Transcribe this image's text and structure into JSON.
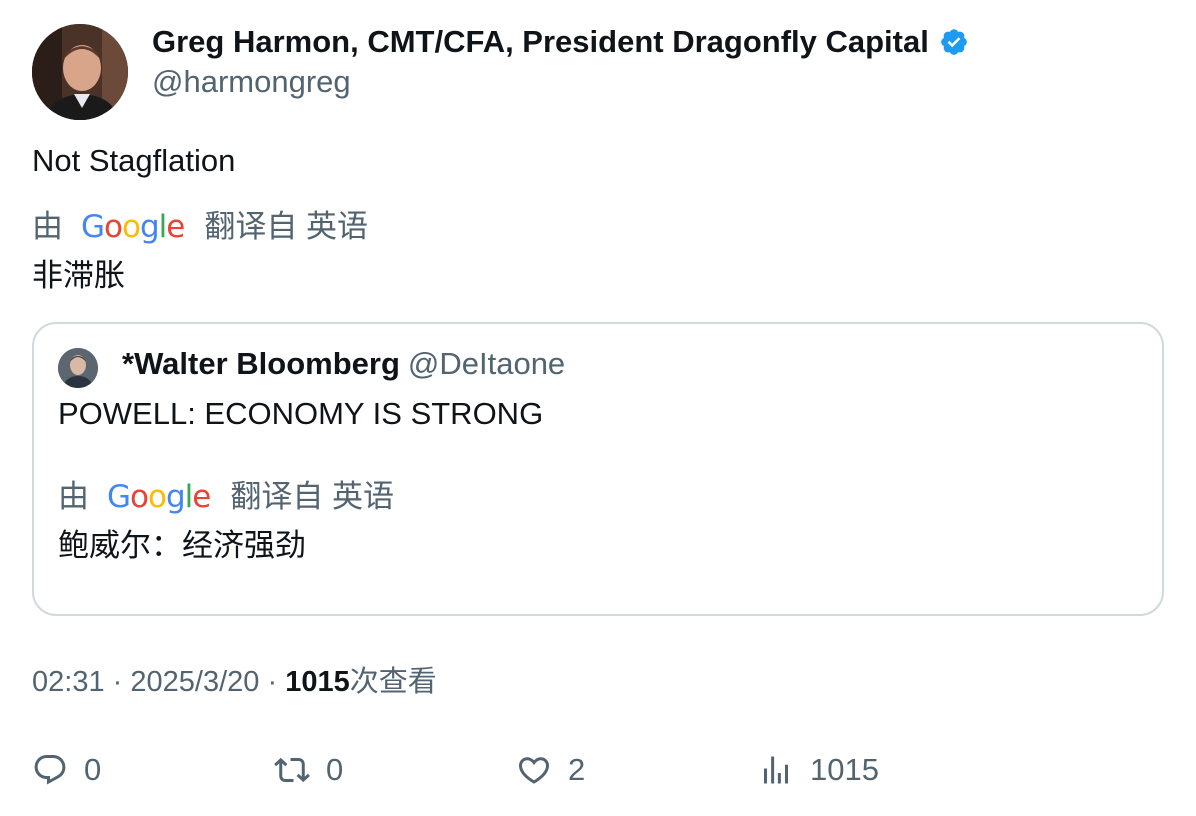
{
  "author": {
    "name": "Greg Harmon, CMT/CFA, President Dragonfly Capital",
    "handle": "@harmongreg",
    "verified": true,
    "verified_color": "#1d9bf0"
  },
  "tweet": {
    "text": "Not Stagflation",
    "translation": {
      "by_label": "由",
      "provider": "Google",
      "translated_from_label": "翻译自 英语",
      "text": "非滞胀"
    }
  },
  "quote": {
    "name": "*Walter Bloomberg",
    "handle": "@DeItaone",
    "text": "POWELL: ECONOMY IS STRONG",
    "translation": {
      "by_label": "由",
      "provider": "Google",
      "translated_from_label": "翻译自 英语",
      "text": "鲍威尔：经济强劲"
    }
  },
  "meta": {
    "time": "02:31",
    "separator": "·",
    "date": "2025/3/20",
    "views_count": "1015",
    "views_label": "次查看"
  },
  "actions": {
    "reply_count": "0",
    "retweet_count": "0",
    "like_count": "2",
    "views_count": "1015"
  },
  "icons": {
    "reply": "reply-icon",
    "retweet": "retweet-icon",
    "like": "heart-icon",
    "views": "analytics-icon",
    "verified": "verified-badge-icon"
  },
  "colors": {
    "text_primary": "#0f1419",
    "text_secondary": "#536471",
    "border": "#cfd9de",
    "google_blue": "#4285f4",
    "google_red": "#ea4335",
    "google_yellow": "#fbbc05",
    "google_green": "#34a853"
  }
}
